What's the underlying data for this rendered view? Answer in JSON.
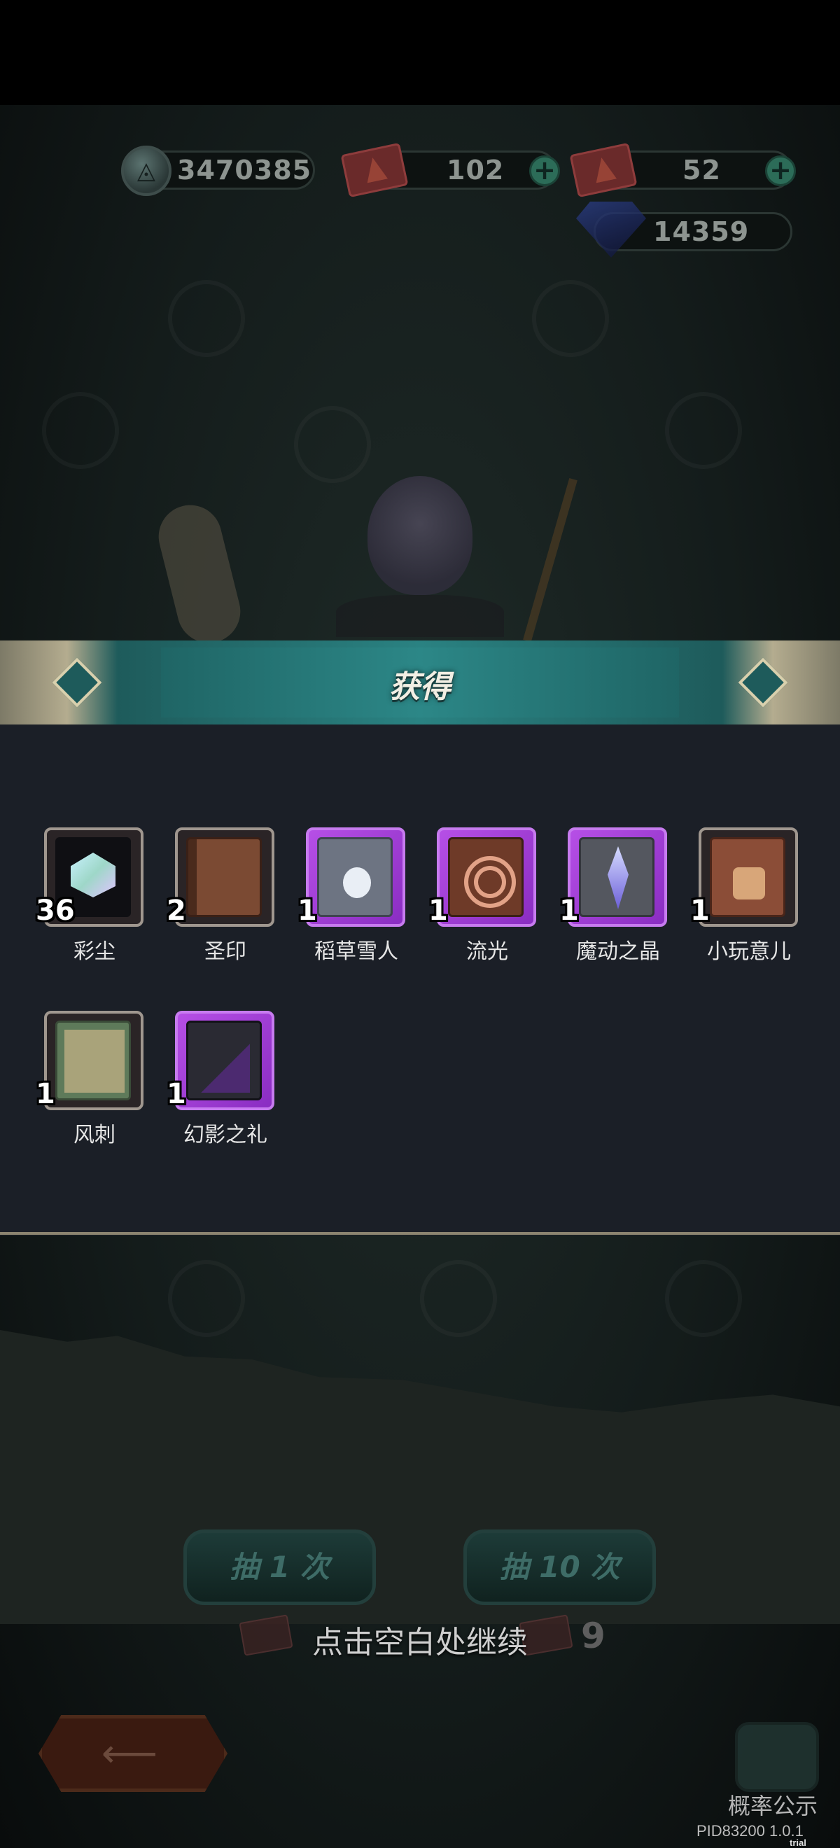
{
  "currencies": {
    "coins": "3470385",
    "ticket_a": "102",
    "ticket_b": "52",
    "gems": "14359"
  },
  "modal": {
    "title": "获得",
    "items": [
      {
        "name": "彩尘",
        "count": "36",
        "icon": "rainbow-dust-icon",
        "rarity": "common"
      },
      {
        "name": "圣印",
        "count": "2",
        "icon": "holy-seal-book-icon",
        "rarity": "common"
      },
      {
        "name": "稻草雪人",
        "count": "1",
        "icon": "scarecrow-snowman-icon",
        "rarity": "epic"
      },
      {
        "name": "流光",
        "count": "1",
        "icon": "streaming-light-icon",
        "rarity": "epic"
      },
      {
        "name": "魔动之晶",
        "count": "1",
        "icon": "magic-crystal-icon",
        "rarity": "epic"
      },
      {
        "name": "小玩意儿",
        "count": "1",
        "icon": "gadget-book-icon",
        "rarity": "common"
      },
      {
        "name": "风刺",
        "count": "1",
        "icon": "wind-thorn-scroll-icon",
        "rarity": "common"
      },
      {
        "name": "幻影之礼",
        "count": "1",
        "icon": "phantom-gift-book-icon",
        "rarity": "epic"
      }
    ]
  },
  "draw": {
    "draw_once_label": "抽 1 次",
    "draw_ten_label": "抽 10 次",
    "ticket_count": "9"
  },
  "hint": "点击空白处继续",
  "footer": {
    "probability_label": "概率公示",
    "build": "PID83200 1.0.1",
    "trial": "trial version"
  },
  "colors": {
    "epic_frame": "#b64fe6",
    "banner": "#2a8282",
    "panel_bg": "#1b1f27"
  }
}
